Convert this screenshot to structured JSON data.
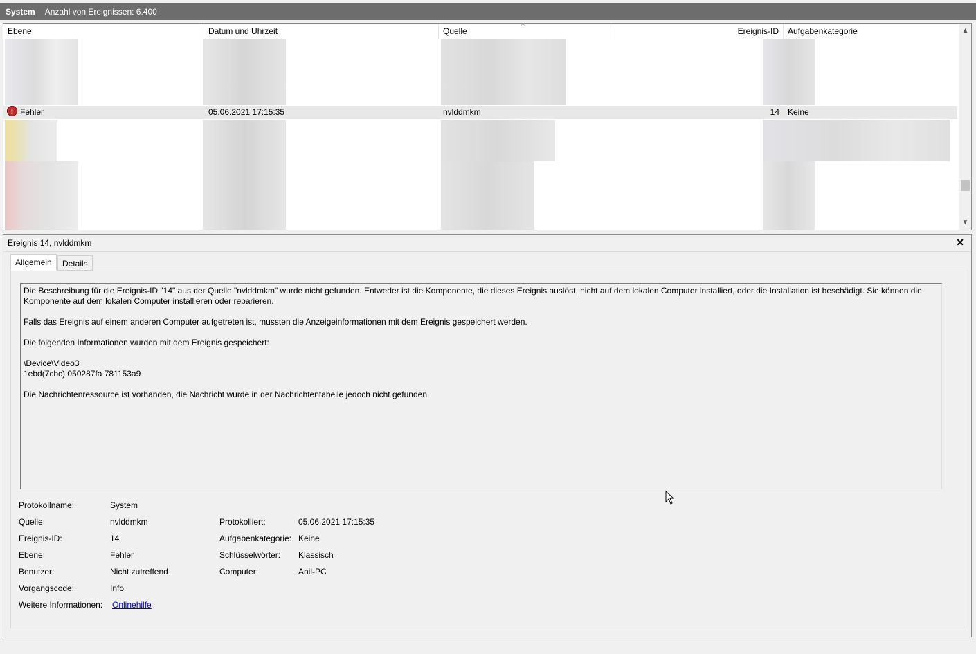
{
  "titlebar": {
    "log_name": "System",
    "event_count": "Anzahl von Ereignissen: 6.400"
  },
  "columns": [
    "Ebene",
    "Datum und Uhrzeit",
    "Quelle",
    "Ereignis-ID",
    "Aufgabenkategorie"
  ],
  "selected_event": {
    "level": "Fehler",
    "datetime": "05.06.2021 17:15:35",
    "source": "nvlddmkm",
    "event_id": "14",
    "category": "Keine",
    "level_icon": "error-icon"
  },
  "detail": {
    "title": "Ereignis 14, nvlddmkm",
    "close_icon": "close-icon",
    "tabs": [
      "Allgemein",
      "Details"
    ],
    "active_tab": "Allgemein",
    "description": [
      "Die Beschreibung für die Ereignis-ID \"14\" aus der Quelle \"nvlddmkm\" wurde nicht gefunden. Entweder ist die Komponente, die dieses Ereignis auslöst, nicht auf dem lokalen Computer installiert, oder die Installation ist beschädigt. Sie können die Komponente auf dem lokalen Computer installieren oder reparieren.",
      "Falls das Ereignis auf einem anderen Computer aufgetreten ist, mussten die Anzeigeinformationen mit dem Ereignis gespeichert werden.",
      "Die folgenden Informationen wurden mit dem Ereignis gespeichert:",
      "\\Device\\Video3\n1ebd(7cbc) 050287fa 781153a9",
      "Die Nachrichtenressource ist vorhanden, die Nachricht wurde in der Nachrichtentabelle jedoch nicht gefunden"
    ],
    "properties": {
      "protokollname_label": "Protokollname:",
      "protokollname": "System",
      "quelle_label": "Quelle:",
      "quelle": "nvlddmkm",
      "protokolliert_label": "Protokolliert:",
      "protokolliert": "05.06.2021 17:15:35",
      "ereignis_id_label": "Ereignis-ID:",
      "ereignis_id": "14",
      "aufgabenkategorie_label": "Aufgabenkategorie:",
      "aufgabenkategorie": "Keine",
      "ebene_label": "Ebene:",
      "ebene": "Fehler",
      "schluesselwoerter_label": "Schlüsselwörter:",
      "schluesselwoerter": "Klassisch",
      "benutzer_label": "Benutzer:",
      "benutzer": "Nicht zutreffend",
      "computer_label": "Computer:",
      "computer": "Anil-PC",
      "vorgangscode_label": "Vorgangscode:",
      "vorgangscode": "Info",
      "weitere_label": "Weitere Informationen:",
      "weitere_link": "Onlinehilfe"
    }
  },
  "colors": {
    "titlebar_bg": "#6d6d6d",
    "selected_row_bg": "#e8e8e8",
    "link": "#0000cc",
    "error_icon": "#c42b2b"
  }
}
